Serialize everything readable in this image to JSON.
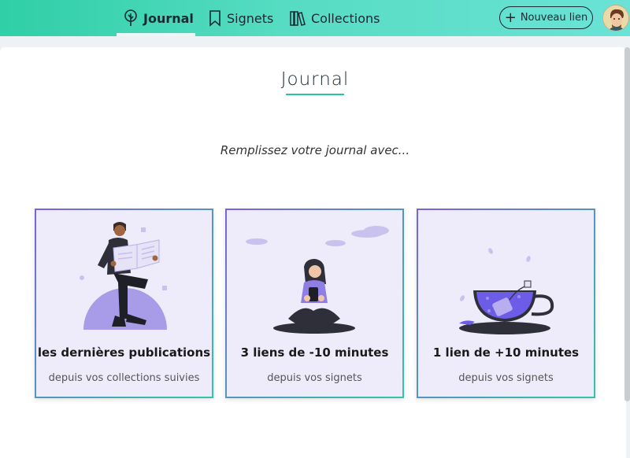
{
  "nav": {
    "journal": "Journal",
    "signets": "Signets",
    "collections": "Collections",
    "new_link": "Nouveau lien"
  },
  "page": {
    "title": "Journal",
    "subtitle": "Remplissez votre journal avec..."
  },
  "cards": [
    {
      "title": "les dernières publications",
      "subtitle": "depuis vos collections suivies",
      "icon": "reading-newspaper-illustration"
    },
    {
      "title": "3 liens de -10 minutes",
      "subtitle": "depuis vos signets",
      "icon": "person-with-phone-illustration"
    },
    {
      "title": "1 lien de +10 minutes",
      "subtitle": "depuis vos signets",
      "icon": "tea-cup-illustration"
    }
  ],
  "colors": {
    "accent": "#27c6a0",
    "illustration": "#6c5ce7",
    "card_background": "#eeecfa"
  }
}
